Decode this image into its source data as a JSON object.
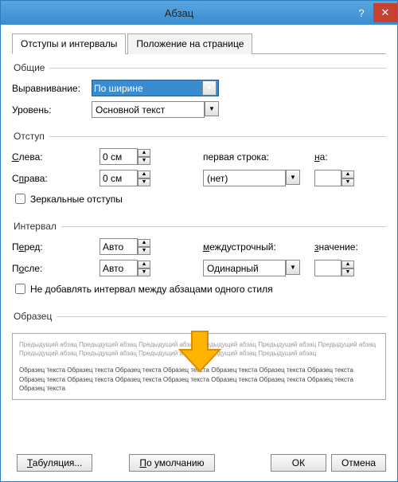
{
  "title": "Абзац",
  "tabs": {
    "t0": "Отступы и интервалы",
    "t1": "Положение на странице"
  },
  "general": {
    "label": "Общие",
    "alignLabel": "Выравнивание:",
    "alignValue": "По ширине",
    "levelLabel": "Уровень:",
    "levelValue": "Основной текст"
  },
  "indent": {
    "label": "Отступ",
    "leftLabel": "Слева:",
    "leftValue": "0 см",
    "rightLabel": "Справа:",
    "rightValue": "0 см",
    "firstLabel": "первая строка:",
    "firstValue": "(нет)",
    "onLabel": "на:",
    "onValue": "",
    "mirror": "Зеркальные отступы"
  },
  "spacing": {
    "label": "Интервал",
    "beforeLabel": "Перед:",
    "beforeValue": "Авто",
    "afterLabel": "После:",
    "afterValue": "Авто",
    "lineLabel": "междустрочный:",
    "lineValue": "Одинарный",
    "valLabel": "значение:",
    "valValue": "",
    "noAdd": "Не добавлять интервал между абзацами одного стиля"
  },
  "preview": {
    "label": "Образец",
    "prev": "Предыдущий абзац Предыдущий абзац Предыдущий абзац Предыдущий абзац Предыдущий абзац Предыдущий абзац Предыдущий абзац Предыдущий абзац Предыдущий абзац Предыдущий абзац Предыдущий абзац",
    "sample": "Образец текста Образец текста Образец текста Образец текста Образец текста Образец текста Образец текста Образец текста Образец текста Образец текста Образец текста Образец текста Образец текста Образец текста Образец текста"
  },
  "buttons": {
    "tabs": "Табуляция...",
    "default": "По умолчанию",
    "ok": "ОК",
    "cancel": "Отмена"
  }
}
